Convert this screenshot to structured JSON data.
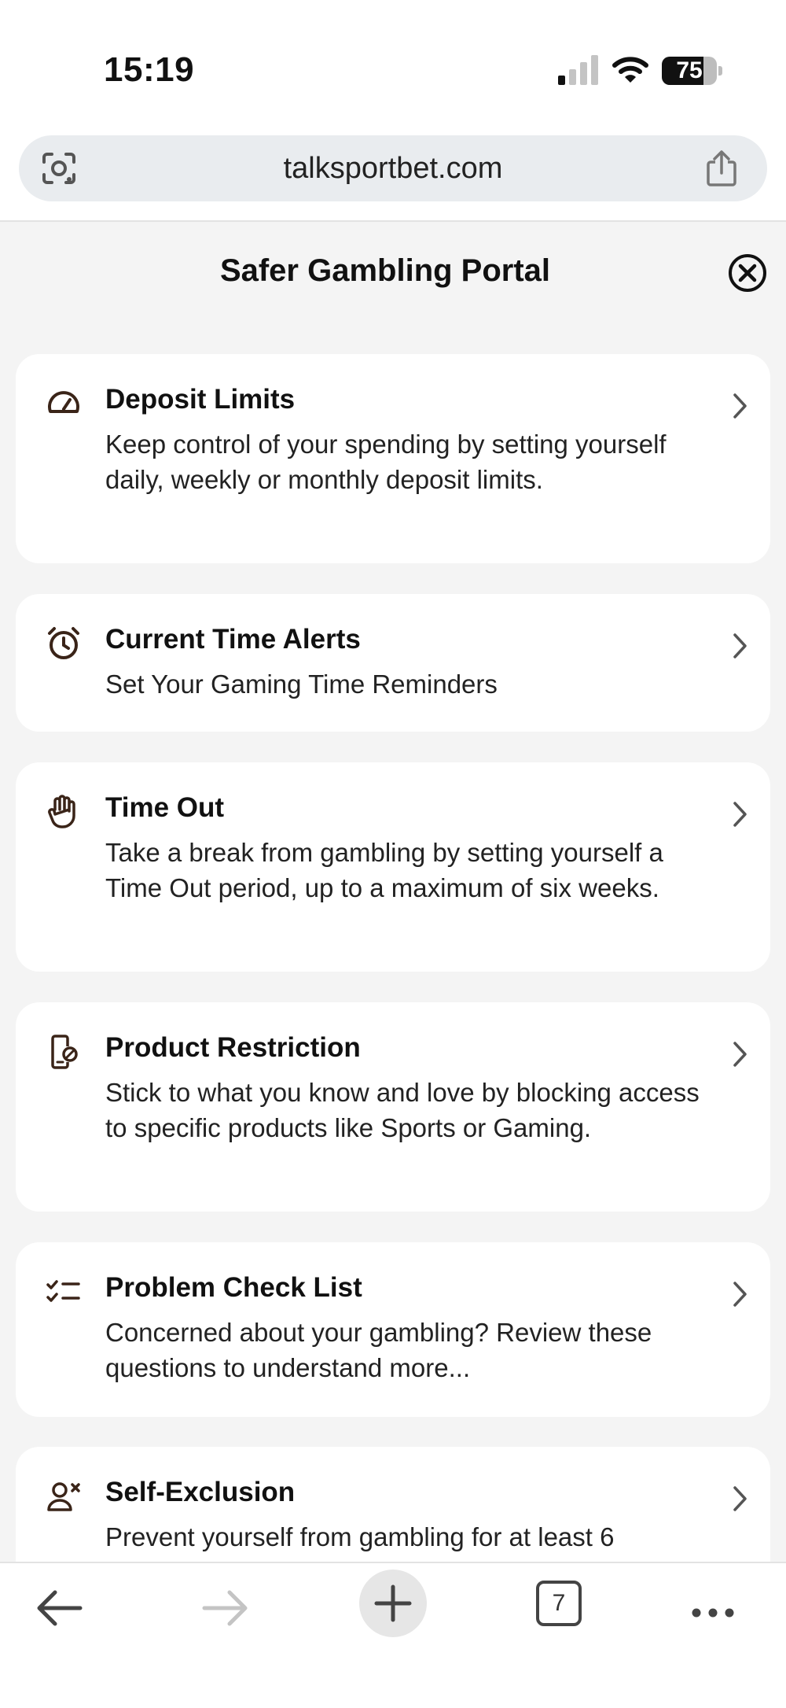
{
  "status_bar": {
    "time": "15:19",
    "battery_level": "75",
    "icons": [
      "cellular-signal-icon",
      "wifi-icon",
      "battery-icon"
    ]
  },
  "browser": {
    "url": "talksportbet.com",
    "icons": [
      "lens-icon",
      "share-icon"
    ]
  },
  "portal": {
    "title": "Safer Gambling Portal",
    "close_icon": "close-circle-icon",
    "items": [
      {
        "title": "Deposit Limits",
        "description": "Keep control of your spending by setting yourself daily, weekly or monthly deposit limits.",
        "icon": "speedometer-icon"
      },
      {
        "title": "Current Time Alerts",
        "description": "Set Your Gaming Time Reminders",
        "icon": "alarm-clock-icon"
      },
      {
        "title": "Time Out",
        "description": "Take a break from gambling by setting yourself a Time Out period, up to a maximum of six weeks.",
        "icon": "hand-stop-icon"
      },
      {
        "title": "Product Restriction",
        "description": "Stick to what you know and love by blocking access to specific products like Sports or Gaming.",
        "icon": "phone-blocked-icon"
      },
      {
        "title": "Problem Check List",
        "description": "Concerned about your gambling? Review these questions to understand more...",
        "icon": "checklist-icon"
      },
      {
        "title": "Self-Exclusion",
        "description": "Prevent yourself from gambling for at least 6",
        "icon": "user-remove-icon"
      }
    ]
  },
  "toolbar": {
    "tab_count": "7",
    "icons": [
      "back-arrow-icon",
      "forward-arrow-icon",
      "new-tab-plus-icon",
      "tabs-icon",
      "more-dots-icon"
    ]
  },
  "colors": {
    "portal_background": "#f4f4f4",
    "card_background": "#ffffff",
    "icon_brown": "#3a2418",
    "url_bar": "#e9ecef"
  }
}
